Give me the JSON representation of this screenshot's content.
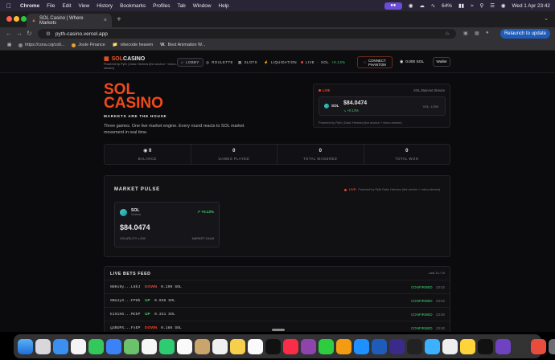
{
  "menubar": {
    "app": "Chrome",
    "items": [
      "File",
      "Edit",
      "View",
      "History",
      "Bookmarks",
      "Profiles",
      "Tab",
      "Window",
      "Help"
    ],
    "battery": "64%",
    "datetime": "Wed 1 Apr  23:42"
  },
  "browser": {
    "tab_title": "SOL Casino | Where Markets",
    "url": "pyth-casino.vercel.app",
    "relaunch_label": "Relaunch to update",
    "bookmarks": [
      "https://cora.coj/coll...",
      "Joule Finance",
      "vibecode heaven",
      "Best Animation W..."
    ]
  },
  "nav": {
    "logo_sol": "SOL",
    "logo_casino": "CASINO",
    "logo_sub": "Powered by Pyth | Data: Hermes (live anchor + micro-stream)",
    "lobby": "LOBBY",
    "roulette": "ROULETTE",
    "slots": "SLOTS",
    "liquidation": "LIQUIDATION",
    "live_label": "LIVE",
    "live_sep": "·",
    "live_symbol": "SOL",
    "live_change": "+0.13%",
    "connect": "CONNECT",
    "phantom": "PHANTOM",
    "balance": "0.000 SOL",
    "wallet": "Wallet"
  },
  "hero": {
    "title_line1": "SOL",
    "title_line2": "CASINO",
    "tagline": "MARKETS ARE THE HOUSE",
    "description": "Three games. One live market engine. Every round reacts to SOL market movement in real time."
  },
  "live_card": {
    "label": "LIVE",
    "network": "SOL Mainnet Stream",
    "symbol": "SOL",
    "price": "$84.0474",
    "change": "+0.13%",
    "volatility": "VOL: LOW",
    "footer": "Powered by Pyth | Data: Hermes (live anchor + micro-stream)"
  },
  "stats": [
    {
      "value": "0",
      "label": "BALANCE"
    },
    {
      "value": "0",
      "label": "GAMES PLAYED"
    },
    {
      "value": "0",
      "label": "TOTAL WAGERED"
    },
    {
      "value": "0",
      "label": "TOTAL WON"
    }
  ],
  "pulse": {
    "title": "MARKET PULSE",
    "live": "LIVE",
    "source": "Powered by Pyth Data: Hermes (live anchor + micro-stream)",
    "name": "SOL",
    "sub": "Solana",
    "change": "+0.13%",
    "price": "$84.0474",
    "volatility": "VOLATILITY: LOW",
    "state": "MARKET CALM"
  },
  "feed": {
    "title": "LIVE BETS FEED",
    "count": "Last 10 / 10",
    "rows": [
      {
        "addr": "N8Kx9y...L8kJ",
        "dir": "DOWN",
        "amount": "0.199 SOL",
        "status": "CONFIRMED",
        "time": "23:42"
      },
      {
        "addr": "5Ba1yX...FPHb",
        "dir": "UP",
        "amount": "0.036 SOL",
        "status": "CONFIRMED",
        "time": "23:42"
      },
      {
        "addr": "Ei9iHG...MCkP",
        "dir": "UP",
        "amount": "0.321 SOL",
        "status": "CONFIRMED",
        "time": "23:40"
      },
      {
        "addr": "g3BUPX...FxEP",
        "dir": "DOWN",
        "amount": "0.186 SOL",
        "status": "CONFIRMED",
        "time": "23:40"
      }
    ]
  },
  "colors": {
    "accent": "#f04a1c",
    "up": "#3ecf6a",
    "down": "#e8452c",
    "background": "#0b0b0d"
  }
}
